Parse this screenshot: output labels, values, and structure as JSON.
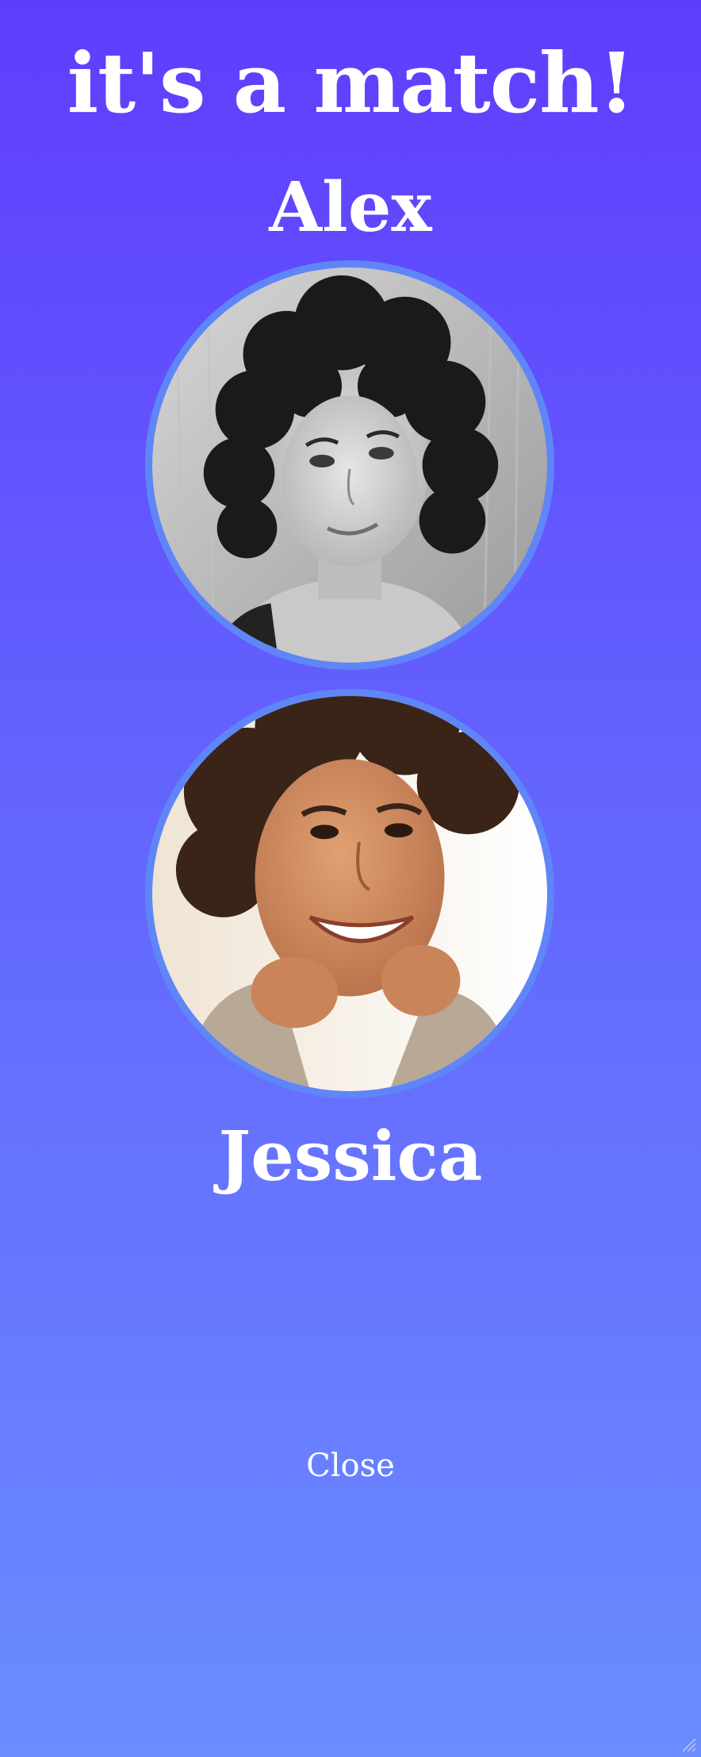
{
  "match": {
    "headline": "it's a match!",
    "user_one": {
      "name": "Alex",
      "photo": "alex-portrait"
    },
    "user_two": {
      "name": "Jessica",
      "photo": "jessica-portrait"
    },
    "close_label": "Close"
  },
  "colors": {
    "gradient_top": "#5f3dfd",
    "gradient_bottom": "#6a8cff",
    "avatar_ring": "#5f86f8",
    "text": "#ffffff"
  },
  "icons": [
    "resize-grip-icon"
  ]
}
